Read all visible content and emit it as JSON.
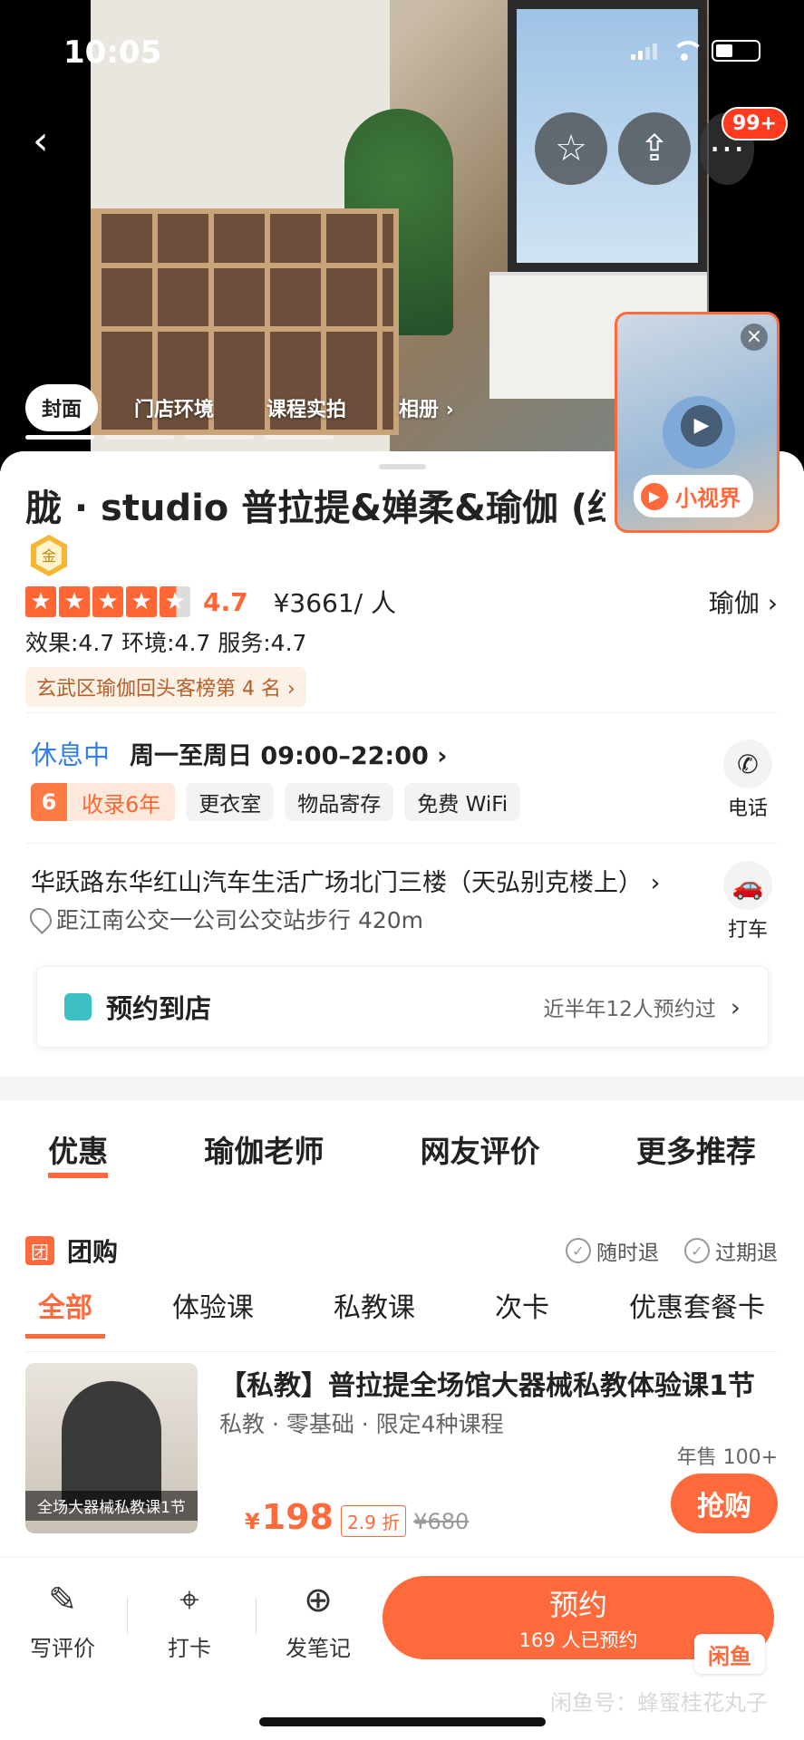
{
  "status_bar": {
    "time": "10:05"
  },
  "hero": {
    "badge": "99+",
    "tabs": [
      "封面",
      "门店环境",
      "课程实拍",
      "相册 ›"
    ],
    "mini_video_brand": "小视界"
  },
  "shop": {
    "title": "胧 · studio 普拉提&婵柔&瑜伽 (红",
    "gold_badge": "金",
    "rating": "4.7",
    "price": "¥3661/ 人",
    "category": "瑜伽 ›",
    "sub_scores": "效果:4.7  环境:4.7  服务:4.7",
    "rank": "玄武区瑜伽回头客榜第 4 名 ›",
    "status": "休息中",
    "hours": "周一至周日 09:00–22:00  ›",
    "years_num": "6",
    "years_label": "收录6年",
    "tags": [
      "更衣室",
      "物品寄存",
      "免费 WiFi"
    ],
    "phone_label": "电话",
    "address": "华跃路东华红山汽车生活广场北门三楼（天弘别克楼上） ›",
    "distance": "距江南公交一公司公交站步行 420m",
    "taxi_label": "打车",
    "booking_label": "预约到店",
    "booking_count": "近半年12人预约过"
  },
  "section_tabs": [
    "优惠",
    "瑜伽老师",
    "网友评价",
    "更多推荐"
  ],
  "group": {
    "icon": "团",
    "title": "团购",
    "assurances": [
      "随时退",
      "过期退"
    ],
    "filters": [
      "全部",
      "体验课",
      "私教课",
      "次卡",
      "优惠套餐卡"
    ]
  },
  "deal": {
    "thumb_caption": "全场大器械私教课1节",
    "name": "【私教】普拉提全场馆大器械私教体验课1节",
    "meta": "私教 · 零基础 · 限定4种课程",
    "sold": "年售 100+",
    "currency": "¥",
    "price": "198",
    "discount": "2.9 折",
    "original": "¥680",
    "buy_label": "抢购"
  },
  "bottom_bar": {
    "review": "写评价",
    "checkin": "打卡",
    "note": "发笔记",
    "reserve": "预约",
    "reserve_count": "169 人已预约",
    "logo": "闲鱼",
    "watermark": "闲鱼号：蜂蜜桂花丸子"
  },
  "colors": {
    "accent": "#ff6a3d",
    "status_blue": "#2f80ed",
    "star": "#ff6633"
  }
}
